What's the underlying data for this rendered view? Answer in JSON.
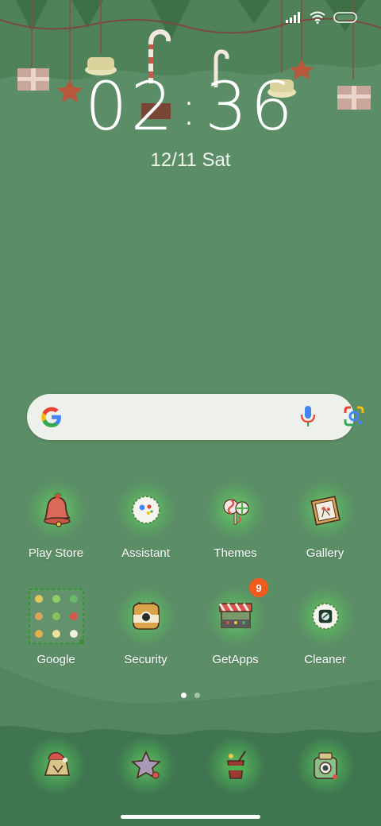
{
  "status_bar": {
    "signal_icon": "cellular-signal-icon",
    "wifi_icon": "wifi-icon",
    "battery_icon": "battery-icon"
  },
  "clock": {
    "hours": "02",
    "separator": ":",
    "minutes": "36"
  },
  "date": {
    "date": "12/11",
    "day": "Sat"
  },
  "search_bar": {
    "logo_icon": "google-g-icon",
    "mic_icon": "microphone-icon",
    "lens_icon": "google-lens-icon"
  },
  "apps_row1": [
    {
      "label": "Play Store",
      "icon": "bell-icon"
    },
    {
      "label": "Assistant",
      "icon": "assistant-icon"
    },
    {
      "label": "Themes",
      "icon": "lollipop-icon"
    },
    {
      "label": "Gallery",
      "icon": "picture-frame-icon"
    }
  ],
  "apps_row2": [
    {
      "label": "Google",
      "icon": "folder-icon"
    },
    {
      "label": "Security",
      "icon": "shield-icon"
    },
    {
      "label": "GetApps",
      "icon": "market-stall-icon",
      "badge": "9"
    },
    {
      "label": "Cleaner",
      "icon": "cleaner-icon"
    }
  ],
  "page_indicator": {
    "count": 2,
    "active": 0
  },
  "dock": [
    {
      "icon": "phone-icon"
    },
    {
      "icon": "message-star-icon"
    },
    {
      "icon": "browser-cup-icon"
    },
    {
      "icon": "camera-icon"
    }
  ],
  "colors": {
    "background": "#5b8d66",
    "badge": "#f25a1e",
    "search_bg": "#eef0ec"
  }
}
